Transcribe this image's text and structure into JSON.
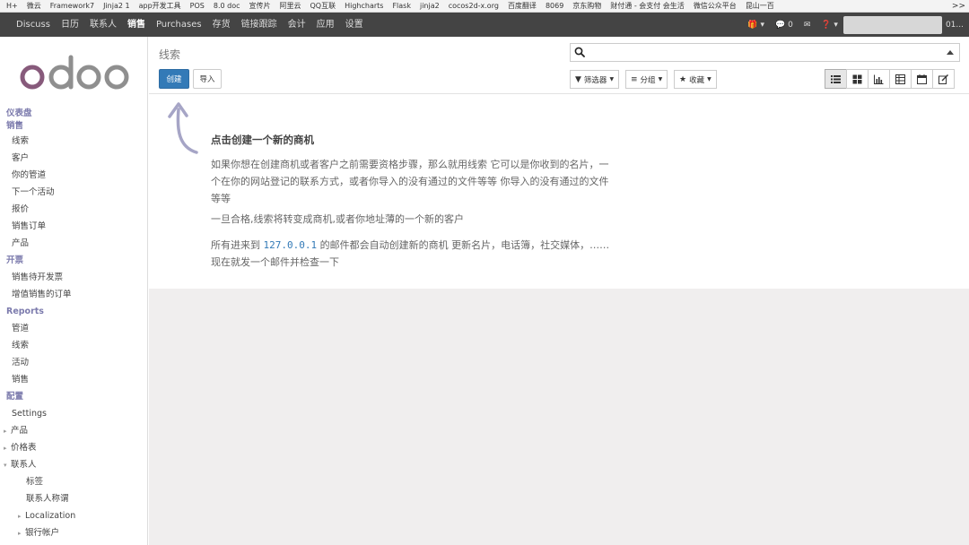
{
  "bookmarks": [
    "H+",
    "微云",
    "Framework7",
    "Jinja2 1",
    "app开发工具",
    "POS",
    "8.0 doc",
    "宣传片",
    "阿里云",
    "QQ互联",
    "Highcharts",
    "Flask",
    "jinja2",
    "cocos2d-x.org",
    "百度翻译",
    "8069",
    "京东购物",
    "财付通 - 会支付 会生活",
    "微信公众平台",
    "昆山一百"
  ],
  "bookmarks_more": ">>",
  "navbar": {
    "items": [
      "Discuss",
      "日历",
      "联系人",
      "销售",
      "Purchases",
      "存货",
      "链接跟踪",
      "会计",
      "应用",
      "设置"
    ],
    "right": {
      "gift": "🎁 ▾",
      "messages": "💬 0",
      "mail": "✉",
      "help": "❓ ▾",
      "user": "01..."
    }
  },
  "sidebar": {
    "logo": "odoo",
    "sections": [
      {
        "title": "仪表盘",
        "items": []
      },
      {
        "title": "销售",
        "items": [
          "线索",
          "客户",
          "你的管道",
          "下一个活动",
          "报价",
          "销售订单",
          "产品"
        ]
      },
      {
        "title": "开票",
        "items": [
          "销售待开发票",
          "增值销售的订单"
        ]
      },
      {
        "title": "Reports",
        "items": [
          "管道",
          "线索",
          "活动",
          "销售"
        ]
      },
      {
        "title": "配置",
        "items": [
          "Settings",
          "产品",
          "价格表",
          "联系人"
        ]
      },
      {
        "title": "",
        "items": [
          "标签",
          "联系人称谓",
          "Localization",
          "银行帐户"
        ]
      }
    ]
  },
  "control_panel": {
    "breadcrumb": "线索",
    "create_label": "创建",
    "import_label": "导入",
    "search_placeholder": "",
    "filters_label": "筛选器",
    "group_label": "分组",
    "favorites_label": "收藏"
  },
  "help": {
    "title": "点击创建一个新的商机",
    "p1": "如果你想在创建商机或者客户之前需要资格步骤，那么就用线索 它可以是你收到的名片，一个在你的网站登记的联系方式，或者你导入的没有通过的文件等等 你导入的没有通过的文件等等",
    "p2": "一旦合格,线索将转变成商机,或者你地址薄的一个新的客户",
    "p3_before": "所有进来到 ",
    "p3_ip": "127.0.0.1",
    "p3_after": " 的邮件都会自动创建新的商机 更新名片，电话簿，社交媒体，……现在就发一个邮件并检查一下"
  },
  "colors": {
    "primary": "#337ab7",
    "navbar": "#444444",
    "section": "#7c7bad",
    "logo": "#875a7b"
  }
}
